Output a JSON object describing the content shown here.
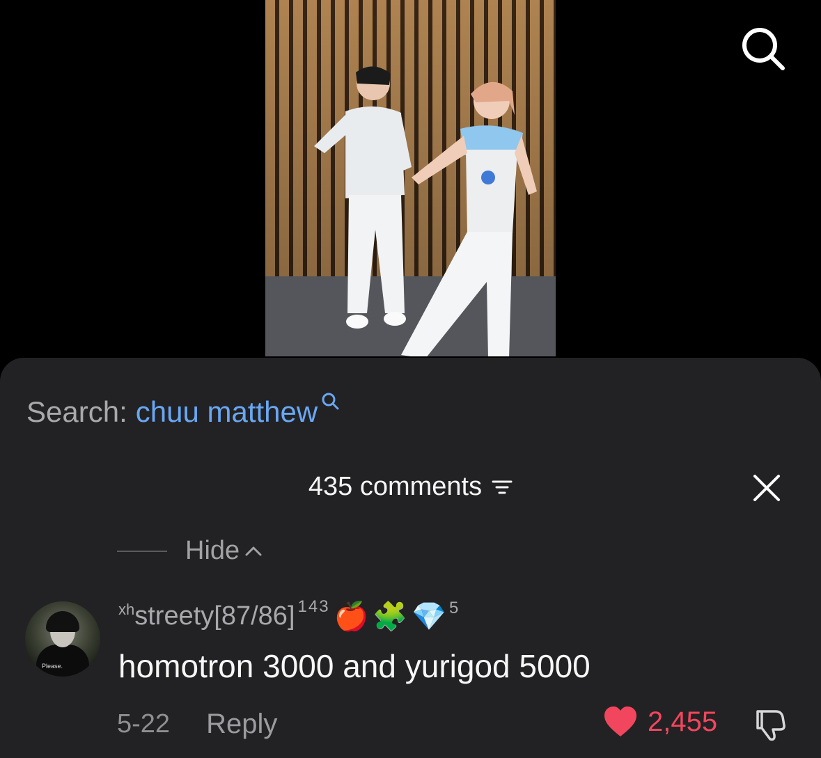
{
  "search": {
    "label": "Search:",
    "term": "chuu matthew"
  },
  "comments": {
    "count_label": "435 comments"
  },
  "thread": {
    "hide_label": "Hide"
  },
  "comment": {
    "username_prefix": "xh",
    "username": "streety[87/86]",
    "username_sup": "143",
    "badges": [
      "🍎",
      "🧩",
      "💎"
    ],
    "badge_count": "5",
    "avatar_caption": "Please.",
    "text": "homotron 3000 and yurigod 5000",
    "date": "5-22",
    "reply_label": "Reply",
    "likes": "2,455"
  },
  "colors": {
    "accent_link": "#6aa7f2",
    "like_red": "#f2465e",
    "sheet_bg": "#222224"
  },
  "icons": {
    "top_search": "search-icon",
    "search_mini": "search-icon",
    "filter": "filter-icon",
    "close": "close-icon",
    "chevron": "chevron-up-icon",
    "like": "heart-icon",
    "dislike": "thumbs-down-icon"
  }
}
